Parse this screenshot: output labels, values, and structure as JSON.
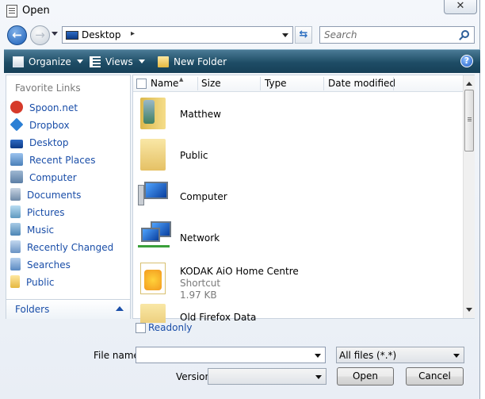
{
  "window": {
    "title": "Open",
    "close_label": "✕"
  },
  "nav": {
    "back_icon": "back-arrow-icon",
    "forward_icon": "forward-arrow-icon",
    "address": "Desktop",
    "address_chevron": "▸",
    "search_placeholder": "Search"
  },
  "toolbar": {
    "organize_label": "Organize",
    "views_label": "Views",
    "new_folder_label": "New Folder",
    "help_label": "?"
  },
  "sidebar": {
    "heading": "Favorite Links",
    "items": [
      {
        "label": "Spoon.net",
        "icon": "spoon-icon",
        "color": "#d63a2a"
      },
      {
        "label": "Dropbox",
        "icon": "dropbox-icon",
        "color": "#2b7fd4"
      },
      {
        "label": "Desktop",
        "icon": "desktop-icon",
        "color": "#1b4f9e"
      },
      {
        "label": "Recent Places",
        "icon": "recent-places-icon",
        "color": "#4a7fb8"
      },
      {
        "label": "Computer",
        "icon": "computer-icon",
        "color": "#5b7ea5"
      },
      {
        "label": "Documents",
        "icon": "documents-icon",
        "color": "#6f8aa8"
      },
      {
        "label": "Pictures",
        "icon": "pictures-icon",
        "color": "#5f9ac0"
      },
      {
        "label": "Music",
        "icon": "music-icon",
        "color": "#4d86b5"
      },
      {
        "label": "Recently Changed",
        "icon": "recently-changed-icon",
        "color": "#6a93c4"
      },
      {
        "label": "Searches",
        "icon": "searches-icon",
        "color": "#5a8ac2"
      },
      {
        "label": "Public",
        "icon": "folder-icon",
        "color": "#e8c35a"
      }
    ],
    "folders_label": "Folders"
  },
  "columns": {
    "name": "Name",
    "size": "Size",
    "type": "Type",
    "date_modified": "Date modified"
  },
  "files": [
    {
      "name": "Matthew",
      "icon": "user-folder-icon"
    },
    {
      "name": "Public",
      "icon": "folder-icon"
    },
    {
      "name": "Computer",
      "icon": "computer-icon"
    },
    {
      "name": "Network",
      "icon": "network-icon"
    },
    {
      "name": "KODAK AiO Home Centre",
      "sub1": "Shortcut",
      "sub2": "1.97 KB",
      "icon": "kodak-shortcut-icon"
    },
    {
      "name": "Old Firefox Data",
      "icon": "folder-icon"
    }
  ],
  "readonly_label": "Readonly",
  "file_name_label": "File name:",
  "file_name_value": "",
  "file_type_value": "All files (*.*)",
  "version_label": "Version",
  "version_value": "",
  "open_label": "Open",
  "cancel_label": "Cancel"
}
